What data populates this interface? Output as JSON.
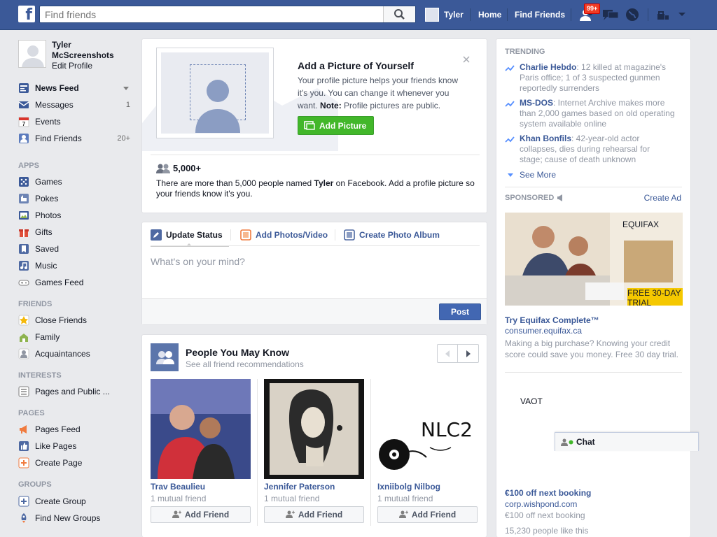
{
  "search": {
    "placeholder": "Find friends"
  },
  "topbar": {
    "user": "Tyler",
    "home": "Home",
    "find_friends": "Find Friends",
    "notif_badge": "99+"
  },
  "profile": {
    "name": "Tyler McScreenshots",
    "edit": "Edit Profile"
  },
  "nav": {
    "favorites": [
      {
        "label": "News Feed",
        "count": "",
        "icon": "news-feed-icon"
      },
      {
        "label": "Messages",
        "count": "1",
        "icon": "messages-icon"
      },
      {
        "label": "Events",
        "count": "",
        "icon": "events-icon"
      },
      {
        "label": "Find Friends",
        "count": "20+",
        "icon": "find-friends-icon"
      }
    ],
    "apps_head": "APPS",
    "apps": [
      "Games",
      "Pokes",
      "Photos",
      "Gifts",
      "Saved",
      "Music",
      "Games Feed"
    ],
    "friends_head": "FRIENDS",
    "friends": [
      "Close Friends",
      "Family",
      "Acquaintances"
    ],
    "interests_head": "INTERESTS",
    "interests": [
      "Pages and Public ..."
    ],
    "pages_head": "PAGES",
    "pages": [
      "Pages Feed",
      "Like Pages",
      "Create Page"
    ],
    "groups_head": "GROUPS",
    "groups": [
      "Create Group",
      "Find New Groups"
    ]
  },
  "picture_prompt": {
    "title": "Add a Picture of Yourself",
    "text": "Your profile picture helps your friends know it's you. You can change it whenever you want.",
    "note_label": "Note:",
    "note_text": "Profile pictures are public.",
    "button": "Add Picture",
    "count": "5,000+",
    "name_pre": "There are more than 5,000 people named",
    "name": "Tyler",
    "name_post": "on Facebook. Add a profile picture so your friends know it's you."
  },
  "composer": {
    "tab1": "Update Status",
    "tab2": "Add Photos/Video",
    "tab3": "Create Photo Album",
    "placeholder": "What's on your mind?",
    "post": "Post"
  },
  "pymk": {
    "title": "People You May Know",
    "subtitle": "See all friend recommendations",
    "add_label": "Add Friend",
    "people": [
      {
        "name": "Trav Beaulieu",
        "mutual": "1 mutual friend"
      },
      {
        "name": "Jennifer Paterson",
        "mutual": "1 mutual friend"
      },
      {
        "name": "Ixniibolg Nilbog",
        "mutual": "1 mutual friend"
      }
    ]
  },
  "trending": {
    "head": "TRENDING",
    "items": [
      {
        "topic": "Charlie Hebdo",
        "text": ": 12 killed at magazine's Paris office; 1 of 3 suspected gunmen reportedly surrenders"
      },
      {
        "topic": "MS-DOS",
        "text": ": Internet Archive makes more than 2,000 games based on old operating system available online"
      },
      {
        "topic": "Khan Bonfils",
        "text": ": 42-year-old actor collapses, dies during rehearsal for stage; cause of death unknown"
      }
    ],
    "see_more": "See More"
  },
  "sponsored": {
    "head": "SPONSORED",
    "create_ad": "Create Ad",
    "ad1": {
      "brand": "EQUIFAX",
      "trial": "FREE 30-DAY TRIAL",
      "title": "Try Equifax Complete™",
      "url": "consumer.equifax.ca",
      "text": "Making a big purchase? Knowing your credit score could save you money. Free 30 day trial."
    },
    "ad2": {
      "logo_text": "VAOT",
      "title": "€100 off next booking",
      "url": "corp.wishpond.com",
      "text": "€100 off next booking",
      "likes": "15,230 people like this"
    }
  },
  "chat": {
    "label": "Chat"
  },
  "colors": {
    "brand": "#3b5998",
    "green": "#42b72a",
    "nav_bg": "#e9eaed"
  }
}
